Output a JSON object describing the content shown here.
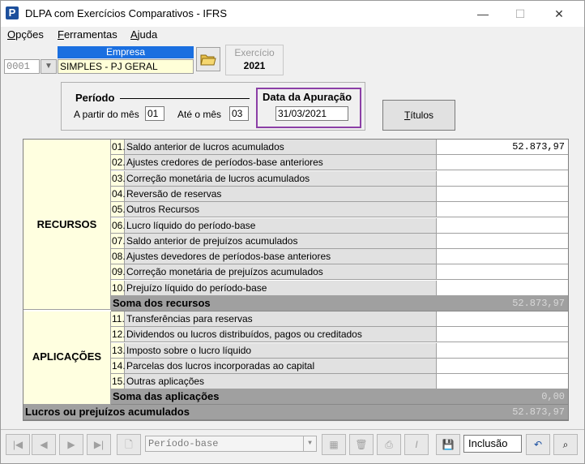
{
  "window": {
    "title": "DLPA com Exercícios Comparativos - IFRS",
    "minimize_glyph": "—",
    "maximize_glyph": "☐",
    "close_glyph": "✕"
  },
  "menu": [
    {
      "pre": "",
      "acc": "O",
      "post": "pções"
    },
    {
      "pre": "",
      "acc": "F",
      "post": "erramentas"
    },
    {
      "pre": "",
      "acc": "A",
      "post": "juda"
    }
  ],
  "empresa": {
    "header": "Empresa",
    "code": "0001",
    "name": "SIMPLES - PJ GERAL"
  },
  "exercicio": {
    "label": "Exercício",
    "value": "2021"
  },
  "periodo": {
    "title": "Período",
    "from_label": "A partir do mês",
    "from_value": "01",
    "to_label": "Até o mês",
    "to_value": "03"
  },
  "apuracao": {
    "title": "Data da Apuração",
    "value": "31/03/2021"
  },
  "titulos_button": {
    "acc": "T",
    "rest": "ítulos"
  },
  "grid": {
    "recursos_label": "RECURSOS",
    "aplicacoes_label": "APLICAÇÕES",
    "recursos_rows": [
      {
        "num": "01.",
        "desc": "Saldo anterior de lucros acumulados",
        "value": "52.873,97"
      },
      {
        "num": "02.",
        "desc": "Ajustes credores de períodos-base anteriores",
        "value": ""
      },
      {
        "num": "03.",
        "desc": "Correção monetária de lucros acumulados",
        "value": ""
      },
      {
        "num": "04.",
        "desc": "Reversão de reservas",
        "value": ""
      },
      {
        "num": "05.",
        "desc": "Outros Recursos",
        "value": ""
      },
      {
        "num": "06.",
        "desc": "Lucro líquido do período-base",
        "value": ""
      },
      {
        "num": "07.",
        "desc": "Saldo anterior de prejuízos acumulados",
        "value": ""
      },
      {
        "num": "08.",
        "desc": "Ajustes devedores de períodos-base anteriores",
        "value": ""
      },
      {
        "num": "09.",
        "desc": "Correção monetária de prejuízos acumulados",
        "value": ""
      },
      {
        "num": "10.",
        "desc": "Prejuízo líquido do período-base",
        "value": ""
      }
    ],
    "soma_recursos": {
      "label": "Soma dos recursos",
      "value": "52.873,97"
    },
    "aplicacoes_rows": [
      {
        "num": "11.",
        "desc": "Transferências para reservas",
        "value": ""
      },
      {
        "num": "12.",
        "desc": "Dividendos ou lucros distribuídos, pagos ou creditados",
        "value": ""
      },
      {
        "num": "13.",
        "desc": "Imposto sobre o lucro líquido",
        "value": ""
      },
      {
        "num": "14.",
        "desc": "Parcelas dos lucros incorporadas ao capital",
        "value": ""
      },
      {
        "num": "15.",
        "desc": "Outras aplicações",
        "value": ""
      }
    ],
    "soma_aplicacoes": {
      "label": "Soma das aplicações",
      "value": "0,00"
    },
    "lucros_acumulados": {
      "label": "Lucros ou prejuízos acumulados",
      "value": "52.873,97"
    }
  },
  "toolbar": {
    "select_value": "Período-base",
    "mode": "Inclusão"
  }
}
